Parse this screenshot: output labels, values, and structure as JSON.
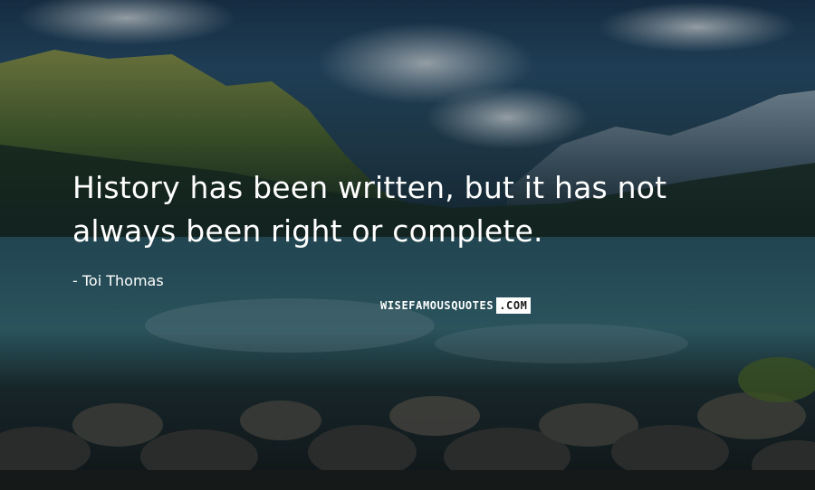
{
  "quote": {
    "line1": "History has been written, but it has not",
    "line2": "always been right or complete."
  },
  "author": {
    "text": "- Toi Thomas"
  },
  "watermark": {
    "main": "WISEFAMOUSQUOTES",
    "suffix": ".COM"
  },
  "colors": {
    "text": "#ffffff",
    "sky": "#2a5170",
    "water": "#2a4d57",
    "mountain_light": "#7a8a3a"
  }
}
